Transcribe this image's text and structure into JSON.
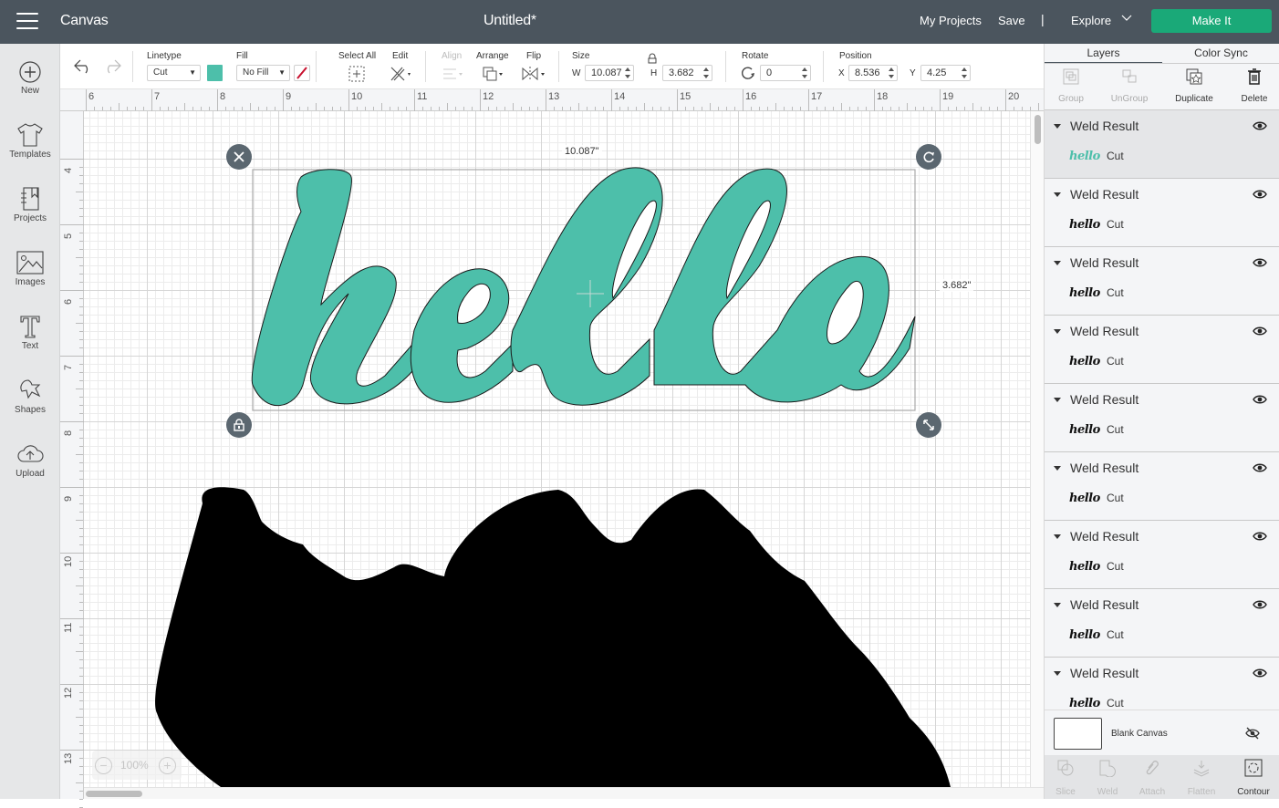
{
  "topbar": {
    "app_name": "Canvas",
    "document_title": "Untitled*",
    "my_projects": "My Projects",
    "save": "Save",
    "separator": "|",
    "explore": "Explore",
    "make_it": "Make It",
    "make_it_color": "#1aa978"
  },
  "leftbar": {
    "items": [
      {
        "label": "New",
        "icon": "plus-circle-icon"
      },
      {
        "label": "Templates",
        "icon": "tshirt-icon"
      },
      {
        "label": "Projects",
        "icon": "notebook-icon"
      },
      {
        "label": "Images",
        "icon": "image-icon"
      },
      {
        "label": "Text",
        "icon": "text-t-icon"
      },
      {
        "label": "Shapes",
        "icon": "shapes-icon"
      },
      {
        "label": "Upload",
        "icon": "cloud-upload-icon"
      }
    ]
  },
  "toolbar": {
    "linetype_label": "Linetype",
    "linetype_value": "Cut",
    "linetype_color": "#4dbfaa",
    "fill_label": "Fill",
    "fill_value": "No Fill",
    "select_all_label": "Select All",
    "edit_label": "Edit",
    "align_label": "Align",
    "arrange_label": "Arrange",
    "flip_label": "Flip",
    "size_label": "Size",
    "w_label": "W",
    "w_value": "10.087",
    "h_label": "H",
    "h_value": "3.682",
    "rotate_label": "Rotate",
    "rotate_value": "0",
    "position_label": "Position",
    "x_label": "X",
    "x_value": "8.536",
    "y_label": "Y",
    "y_value": "4.25"
  },
  "ruler": {
    "top_ticks": [
      "6",
      "7",
      "8",
      "9",
      "10",
      "11",
      "12",
      "13",
      "14",
      "15",
      "16",
      "17",
      "18",
      "19",
      "20"
    ],
    "left_ticks": [
      "4",
      "5",
      "6",
      "7",
      "8",
      "9",
      "10",
      "11",
      "12",
      "13"
    ]
  },
  "canvas": {
    "selected_text": "hello",
    "selected_fill": "#4dbfaa",
    "width_readout": "10.087\"",
    "height_readout": "3.682\"",
    "zoom_level": "100%",
    "zoom_out": "−",
    "zoom_in": "+"
  },
  "panel": {
    "tabs": [
      "Layers",
      "Color Sync"
    ],
    "actions": [
      {
        "label": "Group",
        "enabled": false
      },
      {
        "label": "UnGroup",
        "enabled": false
      },
      {
        "label": "Duplicate",
        "enabled": true
      },
      {
        "label": "Delete",
        "enabled": true
      }
    ],
    "layers": [
      {
        "name": "Weld Result",
        "thumb": "hello",
        "type": "Cut",
        "selected": true
      },
      {
        "name": "Weld Result",
        "thumb": "hello",
        "type": "Cut"
      },
      {
        "name": "Weld Result",
        "thumb": "hello",
        "type": "Cut"
      },
      {
        "name": "Weld Result",
        "thumb": "hello",
        "type": "Cut"
      },
      {
        "name": "Weld Result",
        "thumb": "hello",
        "type": "Cut"
      },
      {
        "name": "Weld Result",
        "thumb": "hello",
        "type": "Cut"
      },
      {
        "name": "Weld Result",
        "thumb": "hello",
        "type": "Cut"
      },
      {
        "name": "Weld Result",
        "thumb": "hello",
        "type": "Cut"
      },
      {
        "name": "Weld Result",
        "thumb": "hello",
        "type": "Cut"
      }
    ],
    "blank_canvas": "Blank Canvas",
    "bottom_actions": [
      {
        "label": "Slice",
        "enabled": false
      },
      {
        "label": "Weld",
        "enabled": false
      },
      {
        "label": "Attach",
        "enabled": false
      },
      {
        "label": "Flatten",
        "enabled": false
      },
      {
        "label": "Contour",
        "enabled": true
      }
    ]
  }
}
